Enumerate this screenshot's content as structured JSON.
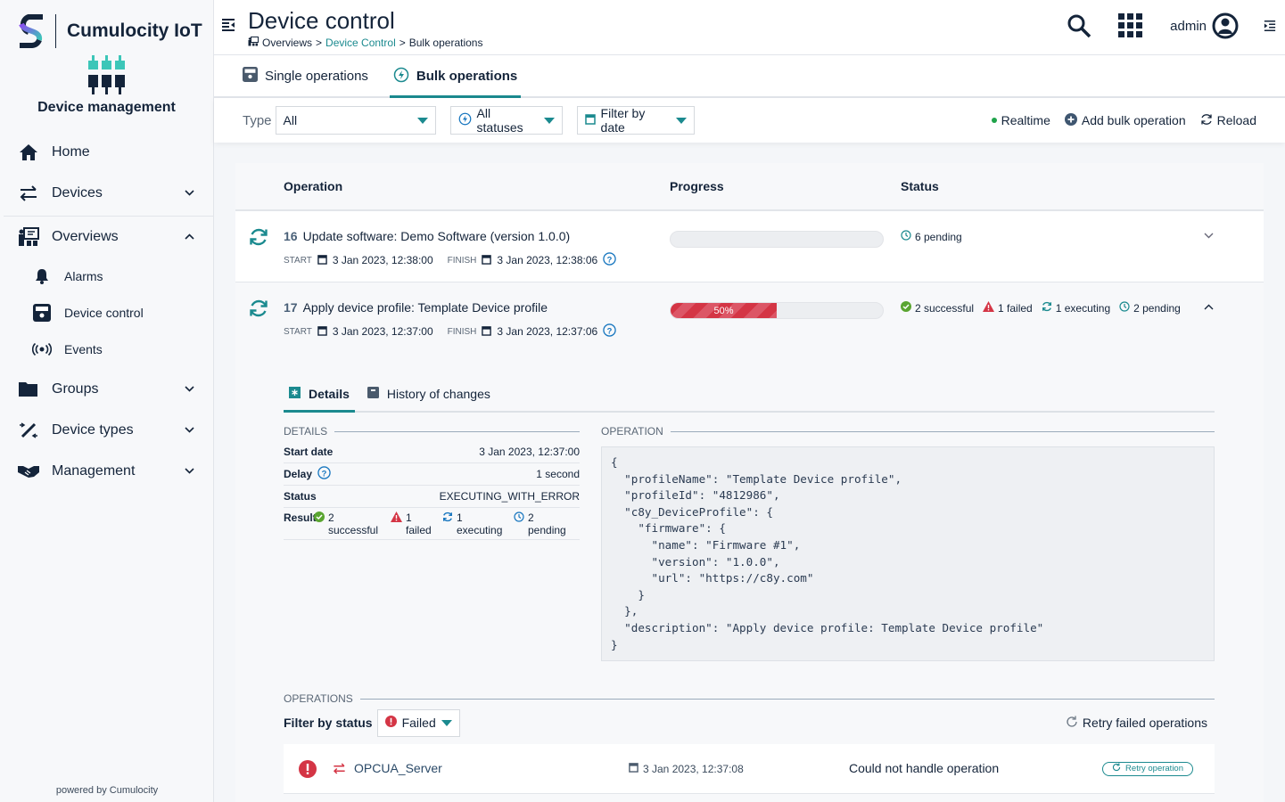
{
  "brand": {
    "name": "Cumulocity IoT",
    "app_name": "Device management",
    "powered_by": "powered by Cumulocity"
  },
  "sidebar": {
    "items": [
      {
        "label": "Home",
        "icon": "home-icon"
      },
      {
        "label": "Devices",
        "icon": "exchange-icon"
      },
      {
        "label": "Overviews",
        "icon": "presentation-icon"
      },
      {
        "label": "Groups",
        "icon": "folder-icon"
      },
      {
        "label": "Device types",
        "icon": "plug-icon"
      },
      {
        "label": "Management",
        "icon": "handshake-icon"
      }
    ],
    "sub_items": [
      {
        "label": "Alarms",
        "icon": "bell-icon"
      },
      {
        "label": "Device control",
        "icon": "device-control-icon"
      },
      {
        "label": "Events",
        "icon": "broadcast-icon"
      }
    ]
  },
  "header": {
    "title": "Device control",
    "breadcrumb": [
      "Overviews",
      "Device Control",
      "Bulk operations"
    ],
    "breadcrumb_sep": ">",
    "user": "admin"
  },
  "tabs": [
    {
      "label": "Single operations"
    },
    {
      "label": "Bulk operations",
      "active": true
    }
  ],
  "filters": {
    "type_label": "Type",
    "type_value": "All",
    "status_value": "All statuses",
    "date_value": "Filter by date",
    "realtime": "Realtime",
    "add": "Add bulk operation",
    "reload": "Reload"
  },
  "table": {
    "headers": [
      "Operation",
      "Progress",
      "Status"
    ],
    "rows": [
      {
        "id": "16",
        "title": "Update software: Demo Software (version 1.0.0)",
        "start_label": "START",
        "start": "3 Jan 2023, 12:38:00",
        "finish_label": "FINISH",
        "finish": "3 Jan 2023, 12:38:06",
        "progress_percent": 0,
        "progress_text": "",
        "status": {
          "pending": "6 pending"
        }
      },
      {
        "id": "17",
        "title": "Apply device profile: Template Device profile",
        "start_label": "START",
        "start": "3 Jan 2023, 12:37:00",
        "finish_label": "FINISH",
        "finish": "3 Jan 2023, 12:37:06",
        "progress_percent": 50,
        "progress_text": "50%",
        "status": {
          "successful": "2 successful",
          "failed": "1 failed",
          "executing": "1 executing",
          "pending": "2 pending"
        }
      }
    ]
  },
  "detail": {
    "tabs": [
      "Details",
      "History of changes"
    ],
    "details_header": "DETAILS",
    "operation_header": "OPERATION",
    "fields": [
      {
        "key": "Start date",
        "value": "3 Jan 2023, 12:37:00"
      },
      {
        "key": "Delay",
        "value": "1 second"
      },
      {
        "key": "Status",
        "value": "EXECUTING_WITH_ERROR"
      }
    ],
    "result_label": "Result",
    "result": [
      {
        "count": "2",
        "label": "successful"
      },
      {
        "count": "1",
        "label": "failed"
      },
      {
        "count": "1",
        "label": "executing"
      },
      {
        "count": "2",
        "label": "pending"
      }
    ],
    "json": "{\n  \"profileName\": \"Template Device profile\",\n  \"profileId\": \"4812986\",\n  \"c8y_DeviceProfile\": {\n    \"firmware\": {\n      \"name\": \"Firmware #1\",\n      \"version\": \"1.0.0\",\n      \"url\": \"https://c8y.com\"\n    }\n  },\n  \"description\": \"Apply device profile: Template Device profile\"\n}"
  },
  "operations": {
    "header": "OPERATIONS",
    "filter_label": "Filter by status",
    "filter_value": "Failed",
    "retry_all": "Retry failed operations",
    "items": [
      {
        "device": "OPCUA_Server",
        "date": "3 Jan 2023, 12:37:08",
        "message": "Could not handle operation",
        "retry": "Retry operation"
      }
    ]
  },
  "colors": {
    "accent": "#1b8a8f",
    "danger": "#d43545",
    "success": "#5aa531",
    "primary_text": "#14243a",
    "info": "#1776bf"
  }
}
